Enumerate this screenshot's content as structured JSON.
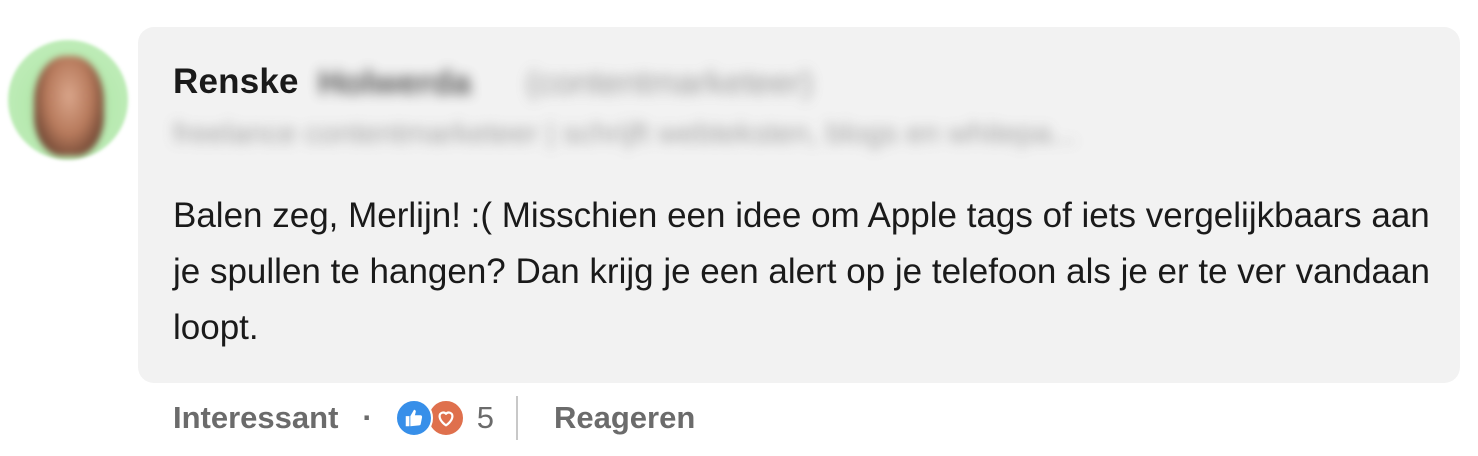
{
  "author": {
    "first_name": "Renske",
    "last_name": "Holwerda",
    "role": "(contentmarketeer)",
    "headline": "freelance contentmarketeer | schrijft webteksten, blogs en whitepa..."
  },
  "comment": {
    "text": "Balen zeg, Merlijn! :( Misschien een idee om Apple tags of iets vergelijkbaars aan je spullen te hangen? Dan krijg je een alert op je telefoon als je er te ver vandaan loopt."
  },
  "actions": {
    "reaction_label": "Interessant",
    "separator": "·",
    "reaction_count": "5",
    "reply_label": "Reageren"
  },
  "icons": {
    "like": "thumbs-up-icon",
    "love": "heart-icon"
  },
  "colors": {
    "bubble": "#f2f2f2",
    "like": "#378fe9",
    "love": "#df704d"
  }
}
